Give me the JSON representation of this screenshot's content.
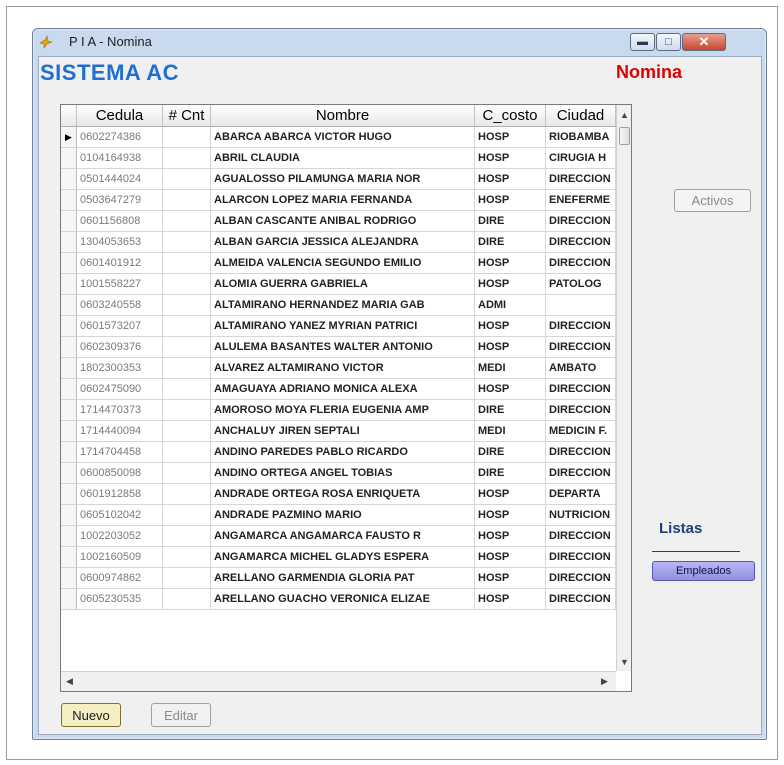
{
  "window": {
    "title": "P I A - Nomina"
  },
  "header": {
    "system_title": "SISTEMA AC",
    "section_title": "Nomina"
  },
  "colors": {
    "system_title": "#1f6fd1",
    "section_title": "#e00000",
    "nuevo_button": "#f5eec2",
    "empleados_button": "#9a9ce6"
  },
  "icons": {
    "app": "bird-icon",
    "minimize": "minimize-icon",
    "maximize": "maximize-icon",
    "close": "close-icon"
  },
  "grid": {
    "columns": [
      "Cedula",
      "# Cnt",
      "Nombre",
      "C_costo",
      "Ciudad"
    ],
    "rows": [
      {
        "cedula": "0602274386",
        "cnt": "",
        "nombre": "ABARCA ABARCA VICTOR HUGO",
        "costo": "HOSP",
        "ciudad": "RIOBAMBA"
      },
      {
        "cedula": "0104164938",
        "cnt": "",
        "nombre": "ABRIL CLAUDIA",
        "costo": "HOSP",
        "ciudad": "CIRUGIA H"
      },
      {
        "cedula": "0501444024",
        "cnt": "",
        "nombre": "AGUALOSSO PILAMUNGA MARIA NOR",
        "costo": "HOSP",
        "ciudad": "DIRECCION"
      },
      {
        "cedula": "0503647279",
        "cnt": "",
        "nombre": "ALARCON LOPEZ MARIA FERNANDA",
        "costo": "HOSP",
        "ciudad": "ENEFERME"
      },
      {
        "cedula": "0601156808",
        "cnt": "",
        "nombre": "ALBAN CASCANTE ANIBAL RODRIGO",
        "costo": "DIRE",
        "ciudad": "DIRECCION"
      },
      {
        "cedula": "1304053653",
        "cnt": "",
        "nombre": "ALBAN GARCIA JESSICA ALEJANDRA",
        "costo": "DIRE",
        "ciudad": "DIRECCION"
      },
      {
        "cedula": "0601401912",
        "cnt": "",
        "nombre": "ALMEIDA VALENCIA SEGUNDO EMILIO",
        "costo": "HOSP",
        "ciudad": "DIRECCION"
      },
      {
        "cedula": "1001558227",
        "cnt": "",
        "nombre": "ALOMIA GUERRA GABRIELA",
        "costo": "HOSP",
        "ciudad": "PATOLOG"
      },
      {
        "cedula": "0603240558",
        "cnt": "",
        "nombre": "ALTAMIRANO HERNANDEZ MARIA GAB",
        "costo": "ADMI",
        "ciudad": ""
      },
      {
        "cedula": "0601573207",
        "cnt": "",
        "nombre": "ALTAMIRANO YANEZ MYRIAN PATRICI",
        "costo": "HOSP",
        "ciudad": "DIRECCION"
      },
      {
        "cedula": "0602309376",
        "cnt": "",
        "nombre": "ALULEMA BASANTES WALTER ANTONIO",
        "costo": "HOSP",
        "ciudad": "DIRECCION"
      },
      {
        "cedula": "1802300353",
        "cnt": "",
        "nombre": "ALVAREZ ALTAMIRANO VICTOR",
        "costo": "MEDI",
        "ciudad": "AMBATO"
      },
      {
        "cedula": "0602475090",
        "cnt": "",
        "nombre": "AMAGUAYA ADRIANO MONICA ALEXA",
        "costo": "HOSP",
        "ciudad": "DIRECCION"
      },
      {
        "cedula": "1714470373",
        "cnt": "",
        "nombre": "AMOROSO MOYA FLERIA EUGENIA AMP",
        "costo": "DIRE",
        "ciudad": "DIRECCION"
      },
      {
        "cedula": "1714440094",
        "cnt": "",
        "nombre": "ANCHALUY JIREN SEPTALI",
        "costo": "MEDI",
        "ciudad": "MEDICIN F."
      },
      {
        "cedula": "1714704458",
        "cnt": "",
        "nombre": "ANDINO PAREDES PABLO RICARDO",
        "costo": "DIRE",
        "ciudad": "DIRECCION"
      },
      {
        "cedula": "0600850098",
        "cnt": "",
        "nombre": "ANDINO ORTEGA ANGEL TOBIAS",
        "costo": "DIRE",
        "ciudad": "DIRECCION"
      },
      {
        "cedula": "0601912858",
        "cnt": "",
        "nombre": "ANDRADE ORTEGA ROSA ENRIQUETA",
        "costo": "HOSP",
        "ciudad": "DEPARTA"
      },
      {
        "cedula": "0605102042",
        "cnt": "",
        "nombre": "ANDRADE PAZMINO MARIO",
        "costo": "HOSP",
        "ciudad": "NUTRICION"
      },
      {
        "cedula": "1002203052",
        "cnt": "",
        "nombre": "ANGAMARCA ANGAMARCA FAUSTO R",
        "costo": "HOSP",
        "ciudad": "DIRECCION"
      },
      {
        "cedula": "1002160509",
        "cnt": "",
        "nombre": "ANGAMARCA MICHEL GLADYS ESPERA",
        "costo": "HOSP",
        "ciudad": "DIRECCION"
      },
      {
        "cedula": "0600974862",
        "cnt": "",
        "nombre": "ARELLANO GARMENDIA GLORIA PAT",
        "costo": "HOSP",
        "ciudad": "DIRECCION"
      },
      {
        "cedula": "0605230535",
        "cnt": "",
        "nombre": "ARELLANO GUACHO VERONICA ELIZAE",
        "costo": "HOSP",
        "ciudad": "DIRECCION"
      }
    ]
  },
  "buttons": {
    "activos": "Activos",
    "nuevo": "Nuevo",
    "editar": "Editar",
    "empleados": "Empleados"
  },
  "sidebar": {
    "listas_label": "Listas"
  }
}
